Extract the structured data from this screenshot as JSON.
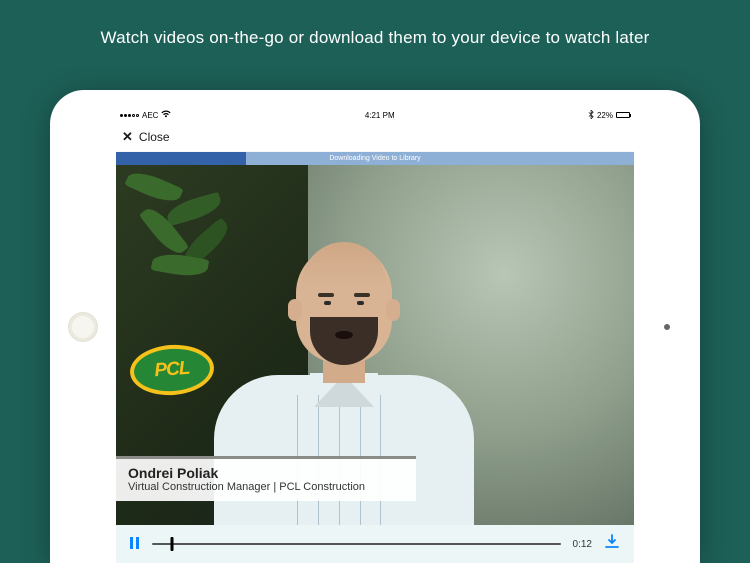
{
  "caption": "Watch videos on-the-go or download them to your device to watch later",
  "status_bar": {
    "carrier": "AEC",
    "time": "4:21 PM",
    "battery_pct": "22%"
  },
  "nav": {
    "close_label": "Close"
  },
  "download_strip": {
    "label": "Downloading Video to Library",
    "progress_fraction": 0.25
  },
  "background_logo": {
    "text": "PCL"
  },
  "lower_third": {
    "name": "Ondrei Poliak",
    "title": "Virtual Construction Manager | PCL Construction"
  },
  "controls": {
    "elapsed": "0:12"
  },
  "colors": {
    "background": "#1d6057",
    "accent": "#0a84ff",
    "control_bg": "#ecf6f7",
    "progress_track": "#8fb0d6",
    "progress_fill": "#3362a8"
  }
}
